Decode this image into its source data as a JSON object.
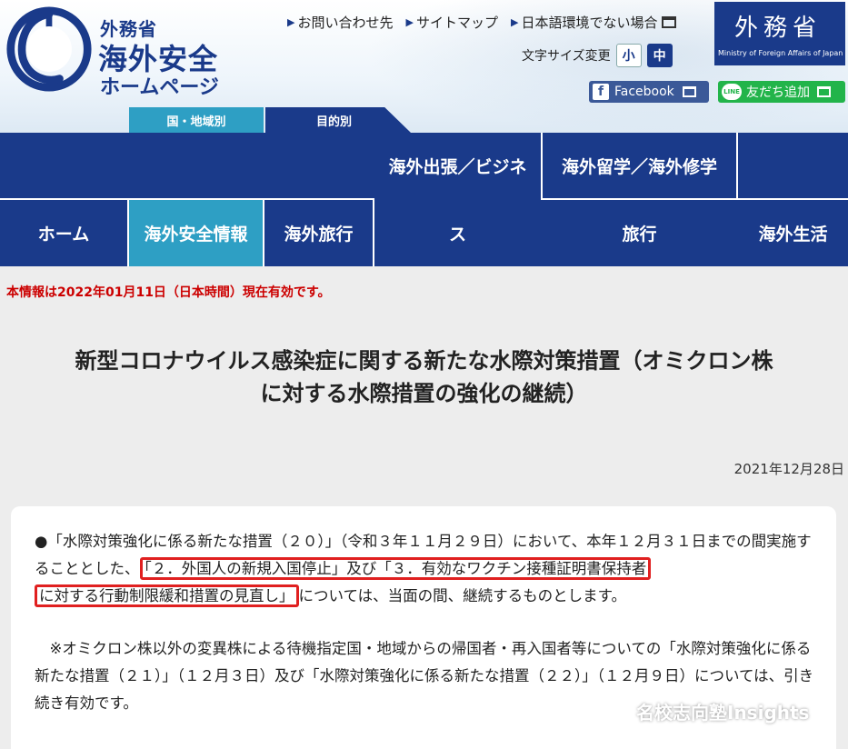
{
  "header": {
    "logo_small": "外務省",
    "logo_big": "海外安全",
    "logo_sub": "ホームページ",
    "links": [
      "お問い合わせ先",
      "サイトマップ",
      "日本語環境でない場合"
    ],
    "font_size_label": "文字サイズ変更",
    "font_size_small": "小",
    "font_size_mid": "中",
    "mofa_jp": "外務省",
    "mofa_en": "Ministry of Foreign Affairs of Japan",
    "facebook": "Facebook",
    "line_badge": "LINE",
    "line": "友だち追加",
    "tab_country": "国・地域別",
    "tab_purpose": "目的別"
  },
  "nav": {
    "business": "海外出張／ビジネ",
    "study": "海外留学／海外修学",
    "home": "ホーム",
    "safety": "海外安全情報",
    "travel": "海外旅行",
    "su": "ス",
    "ryokou": "旅行",
    "life": "海外生活"
  },
  "content": {
    "valid": "本情報は2022年01月11日（日本時間）現在有効です。",
    "title_line1": "新型コロナウイルス感染症に関する新たな水際対策措置（オミクロン株",
    "title_line2": "に対する水際措置の強化の継続）",
    "date": "2021年12月28日",
    "p1_a": "●「水際対策強化に係る新たな措置（２０）」（令和３年１１月２９日）において、本年１２月３１日までの間実施することとした、",
    "p1_hl1": "「２．外国人の新規入国停止」及び「３．有効なワクチン接種証明書保持者",
    "p1_hl2": "に対する行動制限緩和措置の見直し」",
    "p1_b": "については、当面の間、継続するものとします。",
    "p2": "※オミクロン株以外の変異株による待機指定国・地域からの帰国者・再入国者等についての「水際対策強化に係る新たな措置（２１）」（１２月３日）及び「水際対策強化に係る新たな措置（２２）」（１２月９日）については、引き続き有効です。"
  },
  "watermark": "名校志向塾Insights",
  "colors": {
    "navy": "#1a3a8a",
    "teal": "#2e9fc4",
    "alert_red": "#cc0000",
    "highlight_red": "#e02020",
    "facebook": "#3b5998",
    "line": "#22b44a"
  }
}
